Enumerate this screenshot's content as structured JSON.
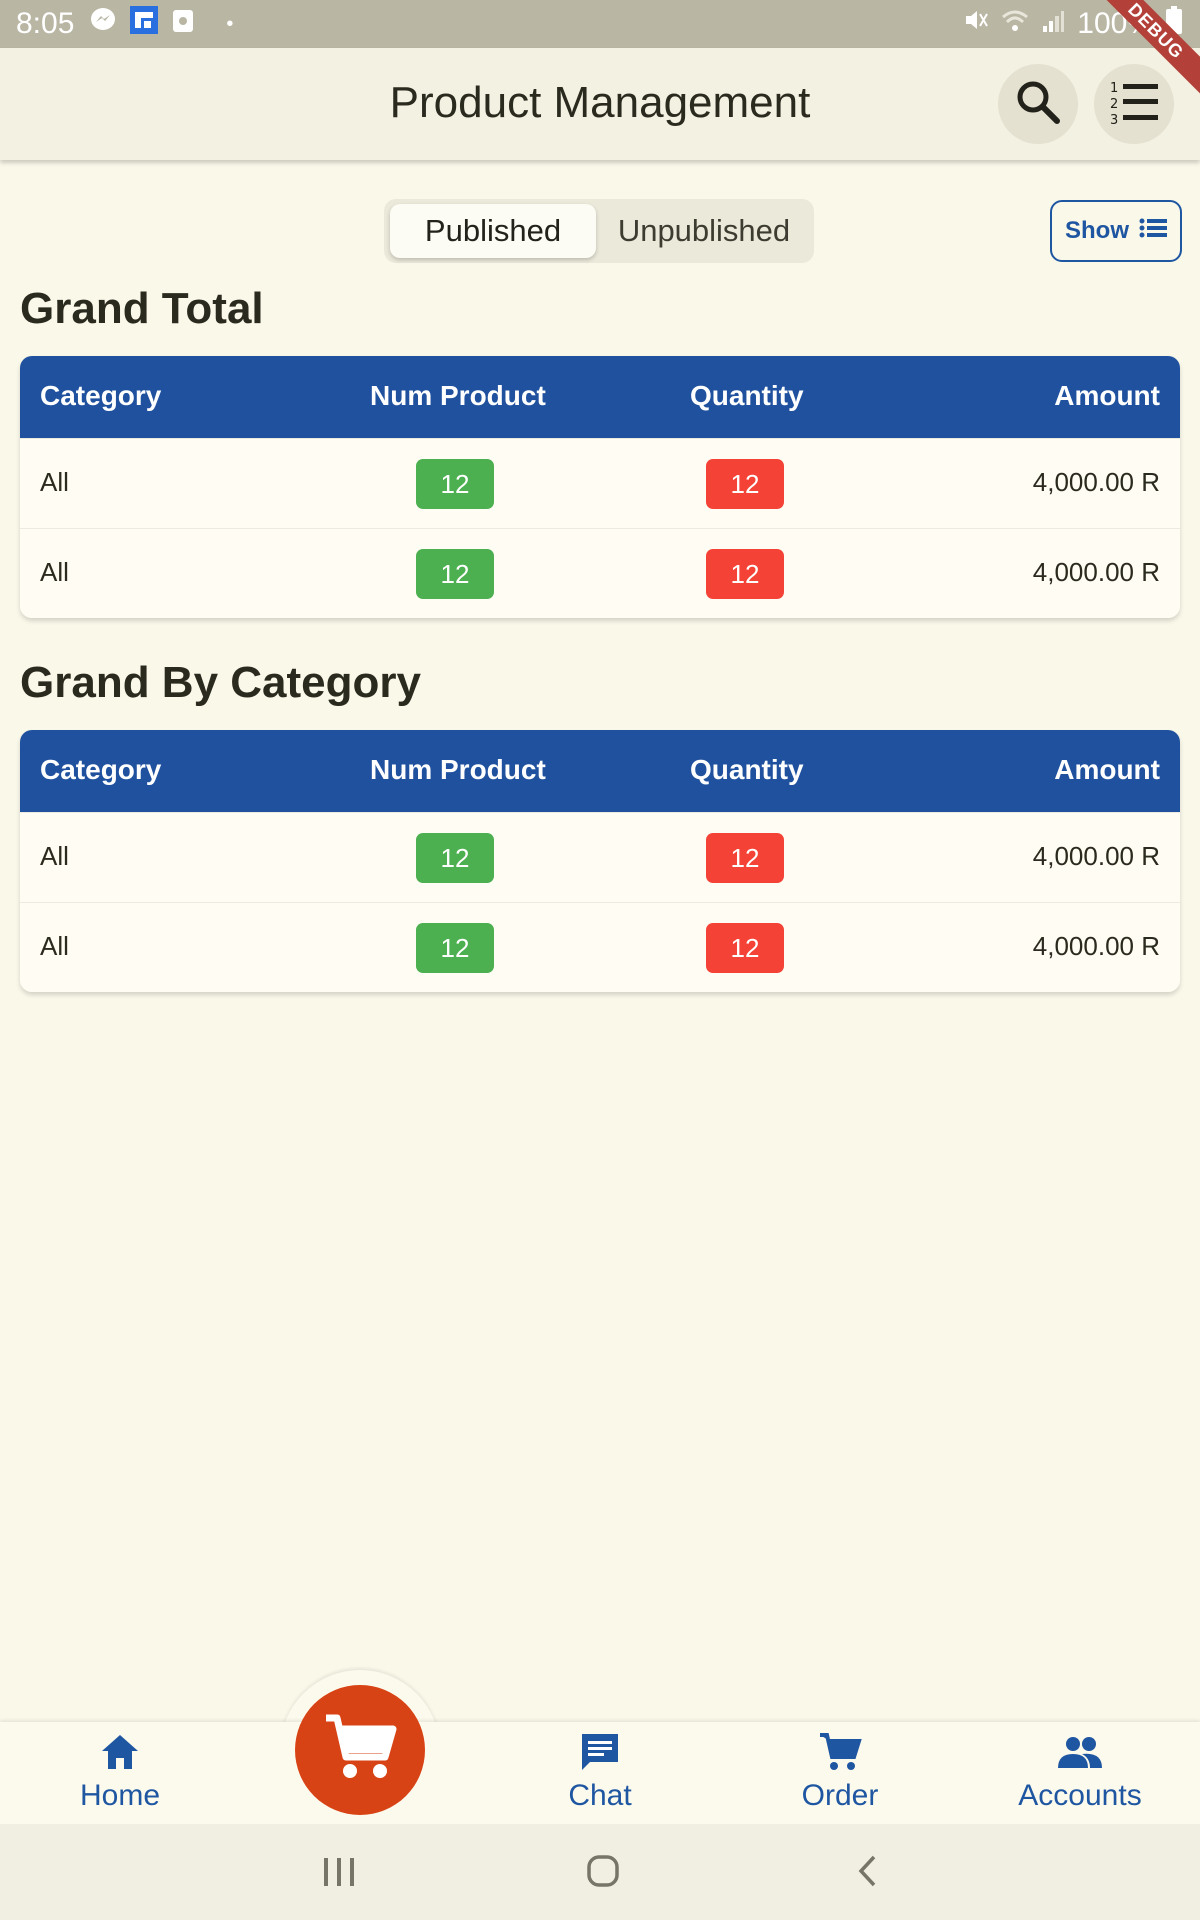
{
  "status_bar": {
    "time": "8:05",
    "battery": "100%",
    "left_icons": [
      "messenger-icon",
      "app-icon",
      "screenshot-icon"
    ],
    "right_icons": [
      "mute-icon",
      "wifi-icon",
      "signal-icon",
      "battery-icon"
    ],
    "debug_banner": "DEBUG"
  },
  "app_bar": {
    "title": "Product Management",
    "actions": [
      "search-icon",
      "numbered-list-icon"
    ]
  },
  "toggle": {
    "published_label": "Published",
    "unpublished_label": "Unpublished",
    "selected": "Published"
  },
  "show_button": {
    "label": "Show",
    "icon": "list-icon"
  },
  "colors": {
    "primary": "#1f519e",
    "green_badge": "#4caf50",
    "red_badge": "#f44336",
    "fab": "#d84315",
    "background": "#faf8e9"
  },
  "grand_total": {
    "title": "Grand Total",
    "headers": [
      "Category",
      "Num Product",
      "Quantity",
      "Amount"
    ],
    "rows": [
      {
        "category": "All",
        "num_product": "12",
        "quantity": "12",
        "amount": "4,000.00 R"
      },
      {
        "category": "All",
        "num_product": "12",
        "quantity": "12",
        "amount": "4,000.00 R"
      }
    ]
  },
  "grand_by_category": {
    "title": "Grand By Category",
    "headers": [
      "Category",
      "Num Product",
      "Quantity",
      "Amount"
    ],
    "rows": [
      {
        "category": "All",
        "num_product": "12",
        "quantity": "12",
        "amount": "4,000.00 R"
      },
      {
        "category": "All",
        "num_product": "12",
        "quantity": "12",
        "amount": "4,000.00 R"
      }
    ]
  },
  "bottom_nav": {
    "home": "Home",
    "chat": "Chat",
    "order": "Order",
    "accounts": "Accounts",
    "fab_icon": "cart-icon"
  },
  "system_nav": [
    "recents-icon",
    "home-circle-icon",
    "back-icon"
  ]
}
